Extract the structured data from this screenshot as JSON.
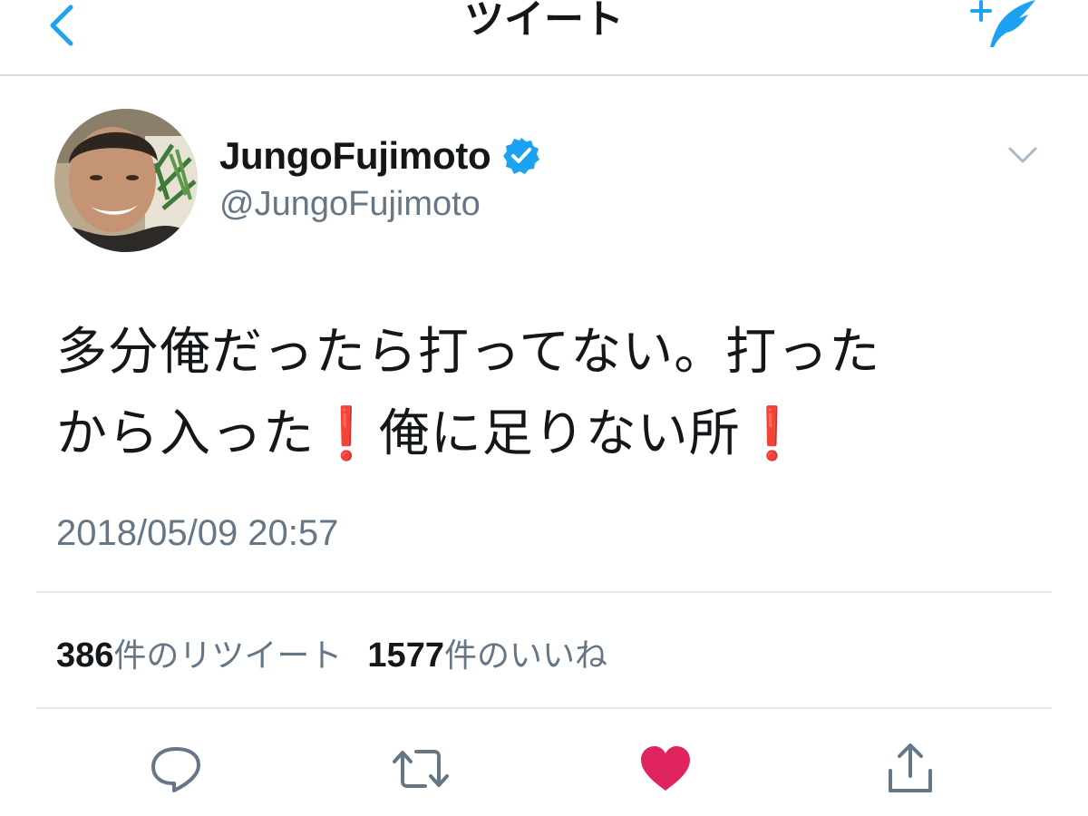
{
  "nav": {
    "title": "ツイート"
  },
  "tweet": {
    "display_name": "JungoFujimoto",
    "handle": "@JungoFujimoto",
    "verified": true,
    "text_line1": "多分俺だったら打ってない。打った",
    "text_line2_a": "から入った",
    "text_line2_b": "俺に足りない所",
    "exclamation": "❗",
    "timestamp": "2018/05/09 20:57"
  },
  "stats": {
    "retweet_count": "386",
    "retweet_label": "件のリツイート",
    "like_count": "1577",
    "like_label": "件のいいね"
  },
  "actions": [
    "reply-icon",
    "retweet-icon",
    "like-icon",
    "share-icon"
  ],
  "colors": {
    "accent": "#1da1f2",
    "like": "#e0245e",
    "muted": "#657786",
    "text": "#14171a",
    "exclaim": "#dd2e44"
  }
}
